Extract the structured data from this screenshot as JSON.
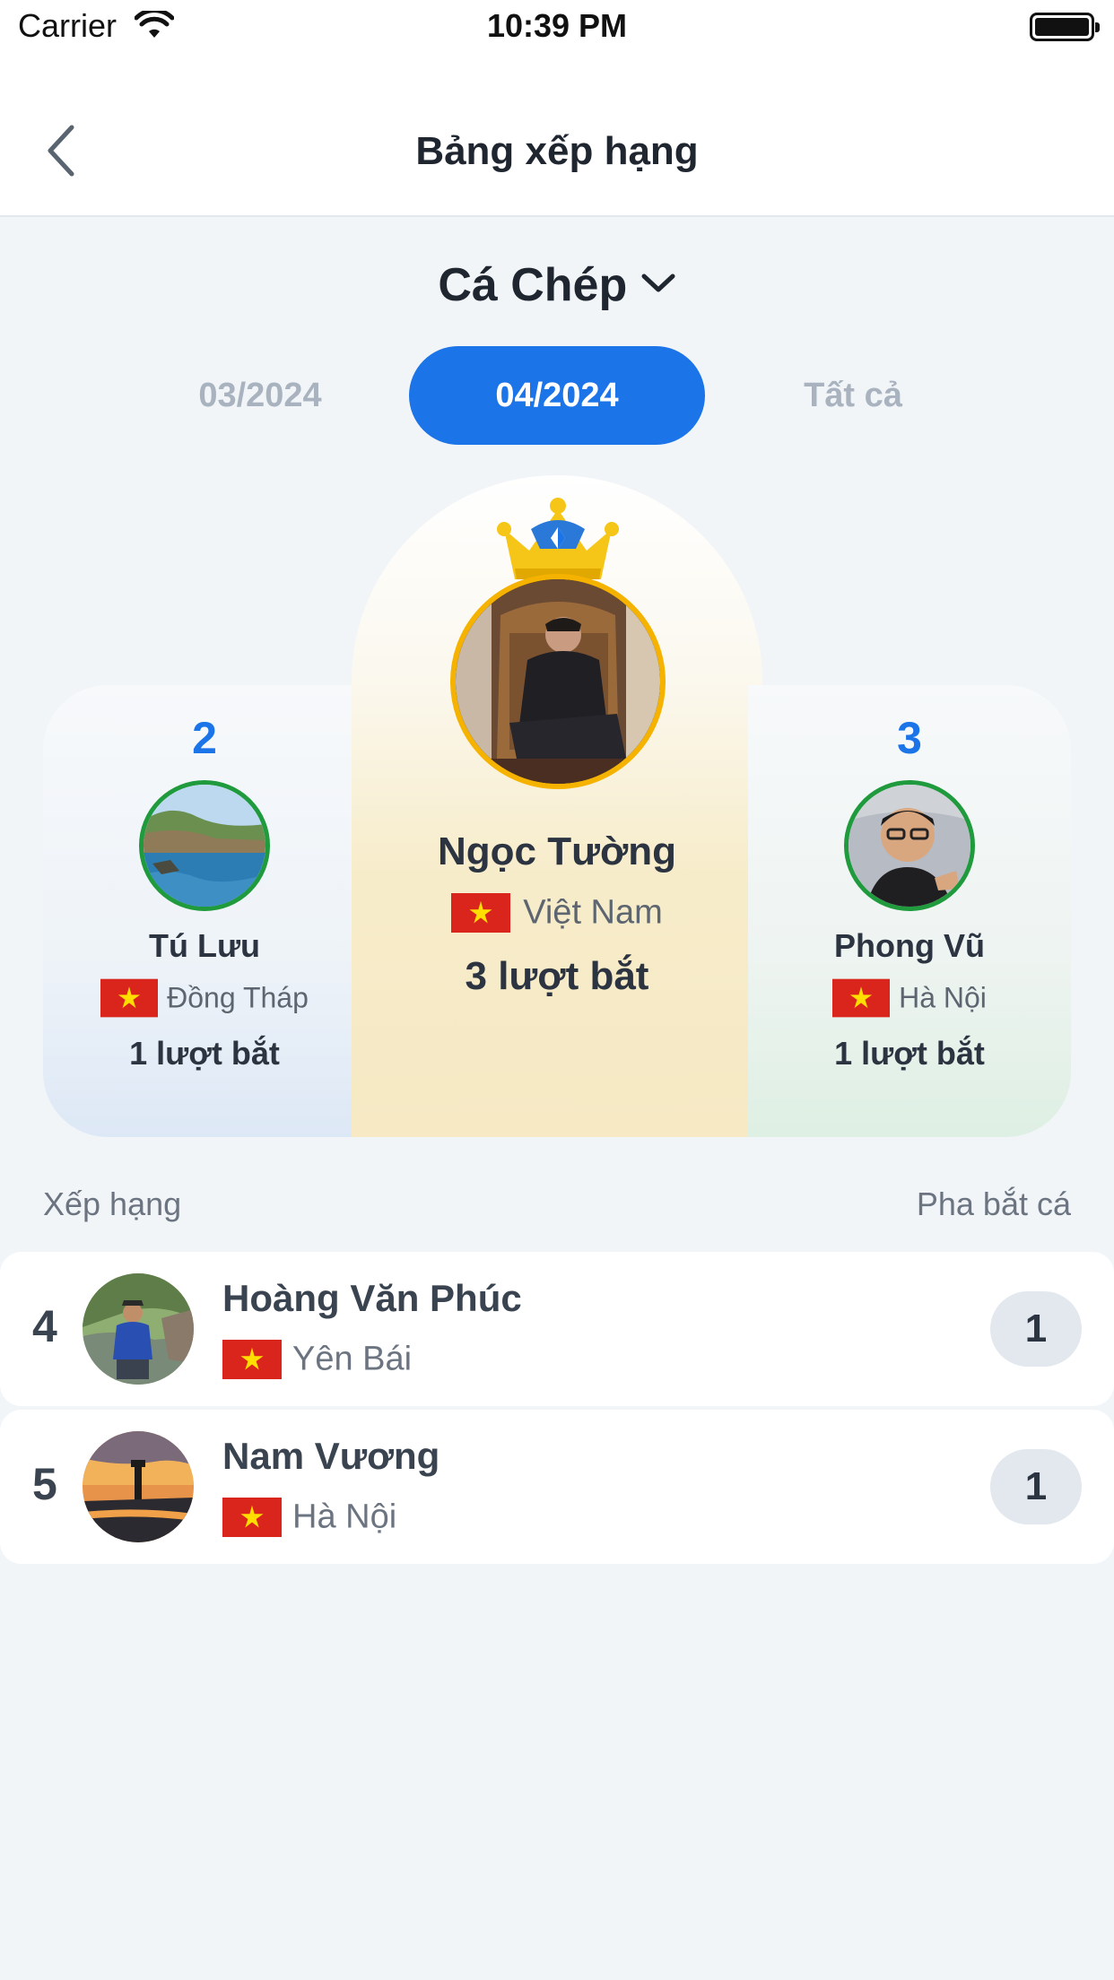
{
  "status_bar": {
    "carrier": "Carrier",
    "time": "10:39 PM"
  },
  "nav": {
    "title": "Bảng xếp hạng",
    "back_icon": "chevron-left-icon"
  },
  "species": {
    "label": "Cá Chép",
    "icon": "chevron-down-icon"
  },
  "tabs": [
    {
      "label": "03/2024",
      "selected": false
    },
    {
      "label": "04/2024",
      "selected": true
    },
    {
      "label": "Tất cả",
      "selected": false
    }
  ],
  "podium": {
    "first": {
      "name": "Ngọc Tường",
      "location": "Việt Nam",
      "score": "3 lượt bắt"
    },
    "second": {
      "rank": "2",
      "name": "Tú Lưu",
      "location": "Đồng Tháp",
      "score": "1 lượt bắt"
    },
    "third": {
      "rank": "3",
      "name": "Phong Vũ",
      "location": "Hà Nội",
      "score": "1 lượt bắt"
    }
  },
  "list": {
    "header_left": "Xếp hạng",
    "header_right": "Pha bắt cá",
    "rows": [
      {
        "rank": "4",
        "name": "Hoàng Văn Phúc",
        "location": "Yên Bái",
        "count": "1"
      },
      {
        "rank": "5",
        "name": "Nam Vương",
        "location": "Hà Nội",
        "count": "1"
      }
    ]
  },
  "colors": {
    "accent": "#1b74e8",
    "gold": "#f5b300",
    "green_ring": "#1f9a3c",
    "flag_red": "#da251d",
    "flag_star": "#ffde00"
  }
}
